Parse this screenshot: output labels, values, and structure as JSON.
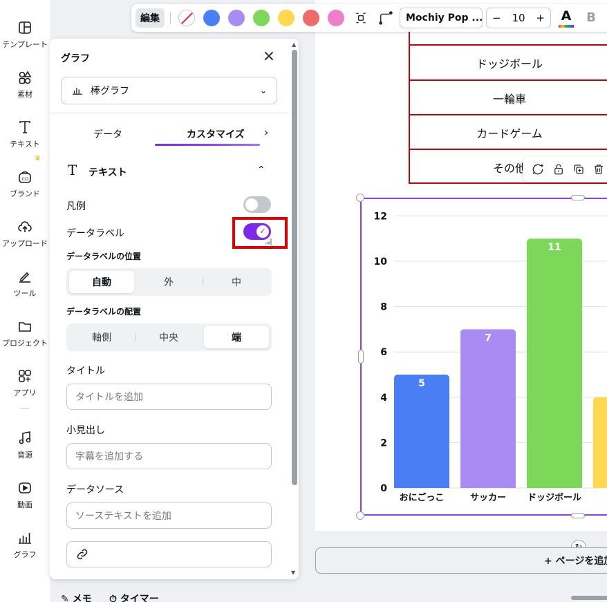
{
  "rail": {
    "items": [
      {
        "label": "テンプレート",
        "icon": "template-icon"
      },
      {
        "label": "素材",
        "icon": "elements-icon"
      },
      {
        "label": "テキスト",
        "icon": "text-icon"
      },
      {
        "label": "ブランド",
        "icon": "brand-icon"
      },
      {
        "label": "アップロード",
        "icon": "upload-icon"
      },
      {
        "label": "ツール",
        "icon": "tools-icon"
      },
      {
        "label": "プロジェクト",
        "icon": "folder-icon"
      },
      {
        "label": "アプリ",
        "icon": "apps-icon"
      },
      {
        "label": "音源",
        "icon": "music-icon"
      },
      {
        "label": "動画",
        "icon": "video-icon"
      },
      {
        "label": "グラフ",
        "icon": "chart-icon"
      }
    ]
  },
  "toolbar": {
    "edit_label": "編集",
    "colors": [
      "#4a7ef5",
      "#a98cf3",
      "#7dd85a",
      "#ffd84f",
      "#f06a6a",
      "#ef7fc8"
    ],
    "font_name": "Mochiy Pop ...",
    "font_size": "10",
    "minus": "−",
    "plus": "+",
    "color_letter": "A",
    "bold_letter": "B"
  },
  "panel": {
    "title": "グラフ",
    "chart_type": "棒グラフ",
    "tabs": [
      {
        "label": "データ"
      },
      {
        "label": "カスタマイズ"
      }
    ],
    "section_title": "テキスト",
    "legend_label": "凡例",
    "legend_on": false,
    "data_label_label": "データラベル",
    "data_label_on": true,
    "position_label": "データラベルの位置",
    "position_options": [
      "自動",
      "外",
      "中"
    ],
    "position_selected": "自動",
    "placement_label": "データラベルの配置",
    "placement_options": [
      "軸側",
      "中央",
      "端"
    ],
    "placement_selected": "端",
    "title_field_label": "タイトル",
    "title_placeholder": "タイトルを追加",
    "subtitle_field_label": "小見出し",
    "subtitle_placeholder": "字幕を追加する",
    "source_field_label": "データソース",
    "source_placeholder": "ソーステキストを追加"
  },
  "table": {
    "rows": [
      "ドッジボール",
      "一輪車",
      "カードゲーム",
      "その他"
    ]
  },
  "canvas": {
    "add_page": "+ ページを追加"
  },
  "footer": {
    "memo": "メモ",
    "timer": "タイマー"
  },
  "chart_data": {
    "type": "bar",
    "categories": [
      "おにごっこ",
      "サッカー",
      "ドッジボール",
      ""
    ],
    "values": [
      5,
      7,
      11,
      4
    ],
    "colors": [
      "#4a7ef5",
      "#a98cf3",
      "#7dd85a",
      "#ffd84f"
    ],
    "data_labels": [
      "5",
      "7",
      "11",
      ""
    ],
    "y_ticks": [
      "0",
      "2",
      "4",
      "6",
      "8",
      "10",
      "12"
    ],
    "ylim": [
      0,
      12
    ],
    "grid": true,
    "legend": false
  }
}
